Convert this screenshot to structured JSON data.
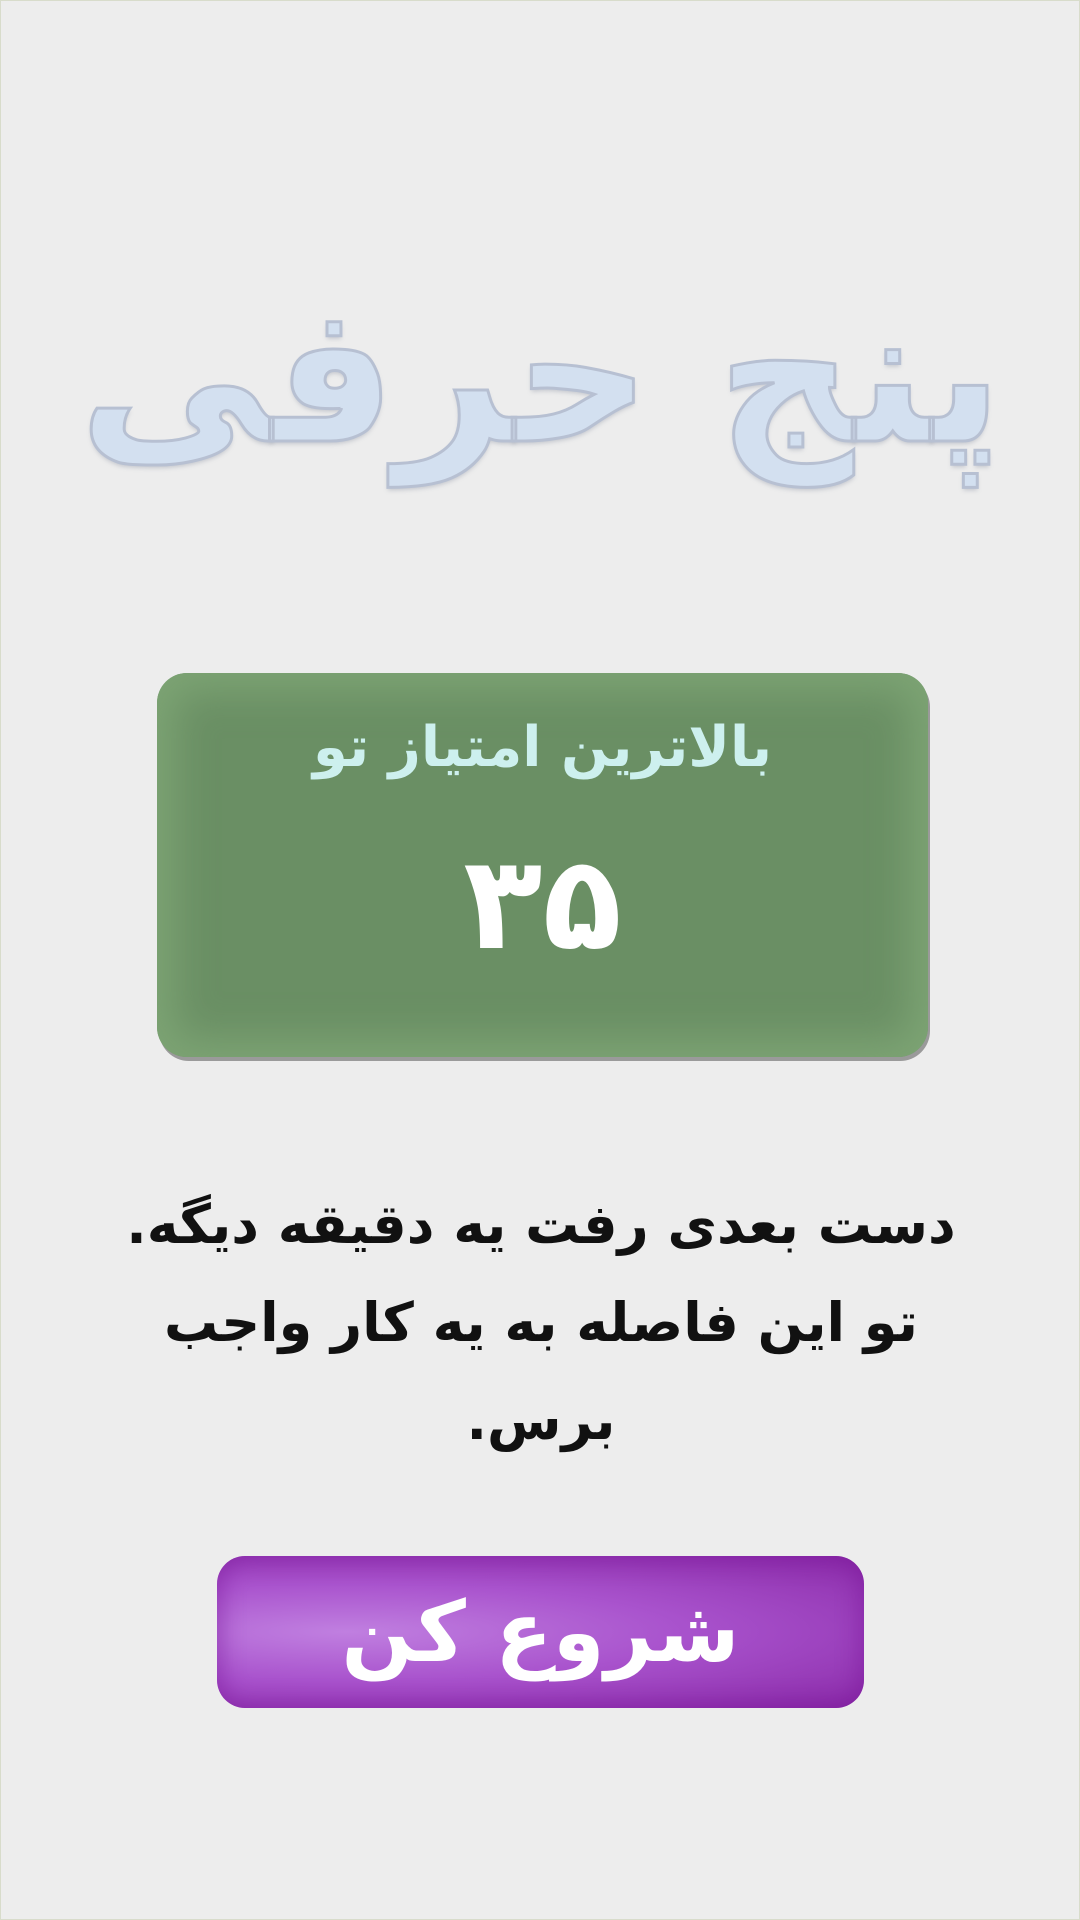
{
  "title": "پنج حرفی",
  "high_score": {
    "label": "بالاترین امتیاز تو",
    "value": "۳۵"
  },
  "message": "دست بعدی رفت یه دقیقه دیگه. تو این فاصله به یه کار واجب برس.",
  "start_button": {
    "label": "شروع کن"
  },
  "colors": {
    "background": "#ededed",
    "title_fill": "#d3e0f0",
    "score_card": "#6a8f64",
    "score_label": "#cdf0ee",
    "start_button": "#a953cd"
  }
}
